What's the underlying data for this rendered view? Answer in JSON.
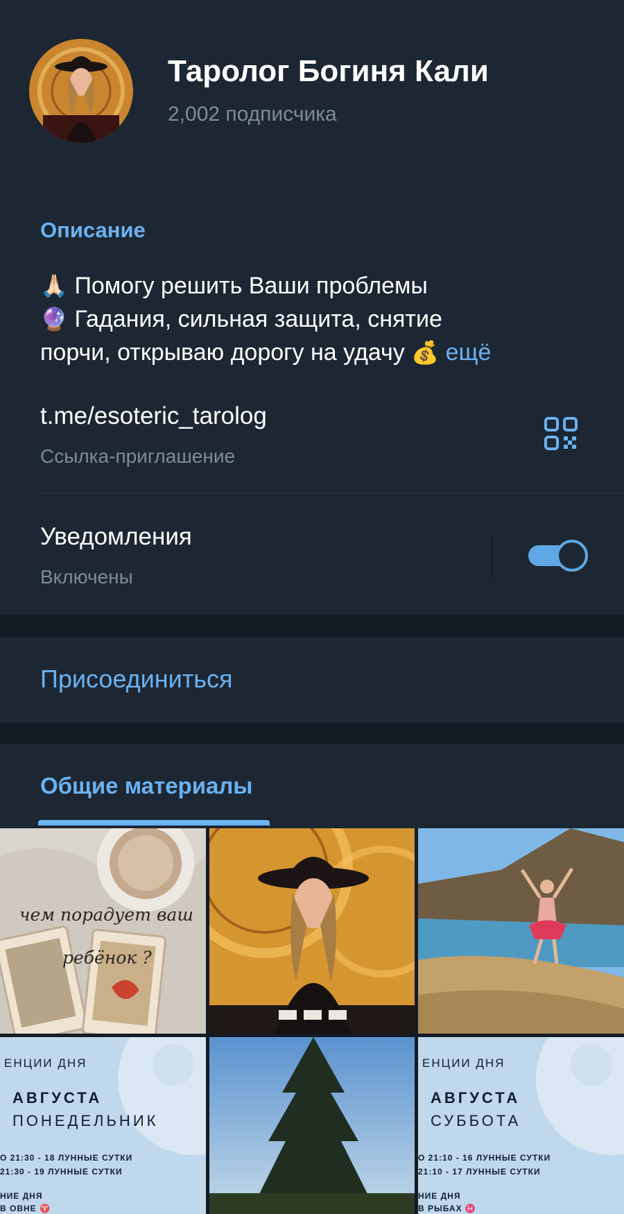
{
  "channel": {
    "title": "Таролог Богиня Кали",
    "subscribers": "2,002 подписчика"
  },
  "description": {
    "label": "Описание",
    "line1": "Помогу решить Ваши проблемы",
    "line2": "Гадания, сильная защита, снятие",
    "line3": "порчи, открываю дорогу на удачу",
    "more": "ещё",
    "emoji1": "🙏🏻",
    "emoji2": "🔮",
    "emoji3": "💰"
  },
  "invite_link": {
    "url": "t.me/esoteric_tarolog",
    "caption": "Ссылка-приглашение",
    "icon": "qr-code-icon"
  },
  "notifications": {
    "label": "Уведомления",
    "status": "Включены",
    "enabled": true
  },
  "join": {
    "label": "Присоединиться"
  },
  "shared_media": {
    "tab_label": "Общие материалы",
    "tiles": [
      {
        "text_line1": "чем порадует ваш",
        "text_line2": "ребёнок ?"
      },
      {},
      {},
      {
        "line1": "ЕНЦИИ ДНЯ",
        "line2": "АВГУСТА",
        "line3": "ПОНЕДЕЛЬНИК",
        "line4": "О 21:30 - 18 ЛУННЫЕ СУТКИ",
        "line5": "21:30 - 19 ЛУННЫЕ СУТКИ",
        "line6": "НИЕ ДНЯ",
        "line7": "В ОВНЕ ♈"
      },
      {},
      {
        "line1": "ЕНЦИИ ДНЯ",
        "line2": "АВГУСТА",
        "line3": "СУББОТА",
        "line4": "О 21:10 - 16 ЛУННЫЕ СУТКИ",
        "line5": "21:10 - 17 ЛУННЫЕ СУТКИ",
        "line6": "НИЕ ДНЯ",
        "line7": "В РЫБАХ ♓"
      }
    ]
  },
  "colors": {
    "accent": "#6ab2f2",
    "panel": "#1d2733",
    "background": "#131b24",
    "muted_text": "#7d8b99"
  }
}
